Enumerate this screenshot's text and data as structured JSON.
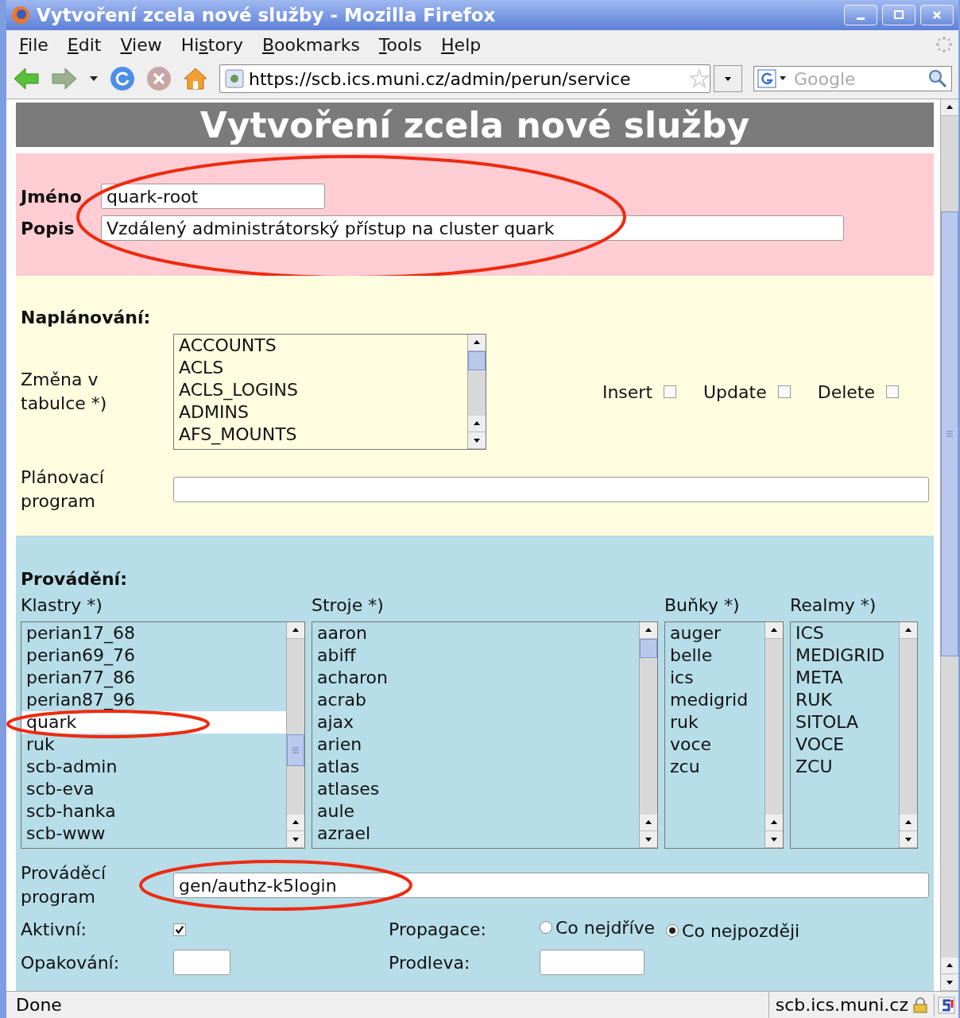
{
  "window": {
    "title": "Vytvoření zcela nové služby - Mozilla Firefox"
  },
  "menu": [
    {
      "label_parts": [
        {
          "text": "F",
          "underlined": true
        },
        {
          "text": "ile",
          "underlined": false
        }
      ]
    },
    {
      "label_parts": [
        {
          "text": "E",
          "underlined": true
        },
        {
          "text": "dit",
          "underlined": false
        }
      ]
    },
    {
      "label_parts": [
        {
          "text": "V",
          "underlined": true
        },
        {
          "text": "iew",
          "underlined": false
        }
      ]
    },
    {
      "label_parts": [
        {
          "text": "Hi",
          "underlined": false
        },
        {
          "text": "s",
          "underlined": true
        },
        {
          "text": "tory",
          "underlined": false
        }
      ]
    },
    {
      "label_parts": [
        {
          "text": "B",
          "underlined": true
        },
        {
          "text": "ookmarks",
          "underlined": false
        }
      ]
    },
    {
      "label_parts": [
        {
          "text": "T",
          "underlined": true
        },
        {
          "text": "ools",
          "underlined": false
        }
      ]
    },
    {
      "label_parts": [
        {
          "text": "H",
          "underlined": true
        },
        {
          "text": "elp",
          "underlined": false
        }
      ]
    }
  ],
  "toolbar": {
    "url": "https://scb.ics.muni.cz/admin/perun/service",
    "search": {
      "placeholder": "Google"
    }
  },
  "page_title": "Vytvoření zcela nové služby",
  "identity": {
    "name": {
      "label": "Jméno",
      "value": "quark-root"
    },
    "description": {
      "label": "Popis",
      "value": "Vzdálený administrátorský přístup na cluster quark"
    }
  },
  "scheduling": {
    "heading": "Naplánování:",
    "table_label": "Změna v tabulce *)",
    "tables": [
      {
        "text": "ACCOUNTS",
        "selected": false
      },
      {
        "text": "ACLS",
        "selected": false
      },
      {
        "text": "ACLS_LOGINS",
        "selected": false
      },
      {
        "text": "ADMINS",
        "selected": false
      },
      {
        "text": "AFS_MOUNTS",
        "selected": false
      }
    ],
    "operations": [
      {
        "label": "Insert",
        "checked": false
      },
      {
        "label": "Update",
        "checked": false
      },
      {
        "label": "Delete",
        "checked": false
      }
    ],
    "program": {
      "label": "Plánovací program"
    }
  },
  "execution": {
    "heading": "Provádění:",
    "lists": [
      {
        "label": "Klastry *)",
        "items": [
          {
            "text": "perian17_68",
            "selected": false
          },
          {
            "text": "perian69_76",
            "selected": false
          },
          {
            "text": "perian77_86",
            "selected": false
          },
          {
            "text": "perian87_96",
            "selected": false
          },
          {
            "text": "quark",
            "selected": true
          },
          {
            "text": "ruk",
            "selected": false
          },
          {
            "text": "scb-admin",
            "selected": false
          },
          {
            "text": "scb-eva",
            "selected": false
          },
          {
            "text": "scb-hanka",
            "selected": false
          },
          {
            "text": "scb-www",
            "selected": false
          }
        ]
      },
      {
        "label": "Stroje *)",
        "items": [
          {
            "text": "aaron",
            "selected": false
          },
          {
            "text": "abiff",
            "selected": false
          },
          {
            "text": "acharon",
            "selected": false
          },
          {
            "text": "acrab",
            "selected": false
          },
          {
            "text": "ajax",
            "selected": false
          },
          {
            "text": "arien",
            "selected": false
          },
          {
            "text": "atlas",
            "selected": false
          },
          {
            "text": "atlases",
            "selected": false
          },
          {
            "text": "aule",
            "selected": false
          },
          {
            "text": "azrael",
            "selected": false
          }
        ]
      },
      {
        "label": "Buňky *)",
        "items": [
          {
            "text": "auger",
            "selected": false
          },
          {
            "text": "belle",
            "selected": false
          },
          {
            "text": "ics",
            "selected": false
          },
          {
            "text": "medigrid",
            "selected": false
          },
          {
            "text": "ruk",
            "selected": false
          },
          {
            "text": "voce",
            "selected": false
          },
          {
            "text": "zcu",
            "selected": false
          }
        ]
      },
      {
        "label": "Realmy *)",
        "items": [
          {
            "text": "ICS",
            "selected": false
          },
          {
            "text": "MEDIGRID",
            "selected": false
          },
          {
            "text": "META",
            "selected": false
          },
          {
            "text": "RUK",
            "selected": false
          },
          {
            "text": "SITOLA",
            "selected": false
          },
          {
            "text": "VOCE",
            "selected": false
          },
          {
            "text": "ZCU",
            "selected": false
          }
        ]
      }
    ],
    "program": {
      "label": "Prováděcí program",
      "value": "gen/authz-k5login"
    },
    "active": {
      "label": "Aktivní:",
      "checked": true
    },
    "propagation": {
      "label": "Propagace:",
      "options": [
        {
          "label": "Co nejdříve",
          "selected": false
        },
        {
          "label": "Co nejpozději",
          "selected": true
        }
      ]
    },
    "repeat": {
      "label": "Opakování:"
    },
    "delay": {
      "label": "Prodleva:"
    }
  },
  "status_bar": {
    "text": "Done",
    "host": "scb.ics.muni.cz"
  }
}
